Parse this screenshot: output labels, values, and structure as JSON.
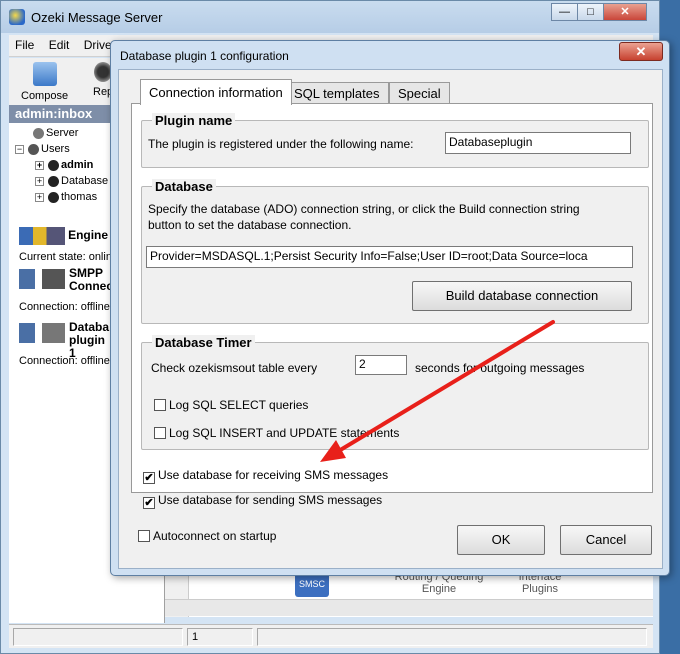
{
  "main_window": {
    "title": "Ozeki Message Server",
    "window_buttons": [
      "—",
      "□",
      "✕"
    ],
    "menu": [
      "File",
      "Edit",
      "Driver"
    ],
    "toolbar": [
      {
        "label": "Compose",
        "icon": "compose-icon"
      },
      {
        "label": "Rep",
        "icon": "reply-icon"
      }
    ],
    "tree_header": "admin:inbox",
    "tree": {
      "server": "Server",
      "users": "Users",
      "admin": "admin",
      "database": "Database",
      "thomas": "thomas"
    },
    "connections": [
      {
        "name": "Engine",
        "state": "Current state: online"
      },
      {
        "name_line1": "SMPP",
        "name_line2": "Connect",
        "state": "Connection: offline"
      },
      {
        "name_line1": "Databa",
        "name_line2": "plugin 1",
        "state": "Connection: offline"
      }
    ],
    "background_labels": {
      "routing_line1": "Routing / Queuing",
      "routing_line2": "Engine",
      "interface_line1": "Interface",
      "interface_line2": "Plugins",
      "smsc": "SMSC"
    },
    "status_page": "1"
  },
  "dialog": {
    "title": "Database plugin 1 configuration",
    "close_symbol": "✕",
    "tabs": [
      "Connection information",
      "SQL templates",
      "Special"
    ],
    "active_tab": 0,
    "plugin_name": {
      "title": "Plugin name",
      "text": "The plugin is registered under the following name:",
      "value": "Databaseplugin"
    },
    "database": {
      "title": "Database",
      "desc_line1": "Specify the database (ADO) connection string, or click the Build connection string",
      "desc_line2": "button to set the database connection.",
      "connection_string": "Provider=MSDASQL.1;Persist Security Info=False;User ID=root;Data Source=loca",
      "build_button": "Build database connection"
    },
    "timer": {
      "title": "Database Timer",
      "prefix": "Check ozekismsout table every",
      "seconds": "2",
      "suffix": "seconds for outgoing messages",
      "log_select": "Log SQL SELECT queries",
      "log_select_checked": false,
      "log_insert": "Log SQL INSERT and UPDATE statements",
      "log_insert_checked": false
    },
    "use_receiving": "Use database for receiving SMS messages",
    "use_receiving_checked": true,
    "use_sending": "Use database for sending SMS messages",
    "use_sending_checked": true,
    "autoconnect": "Autoconnect on startup",
    "autoconnect_checked": false,
    "ok_button": "OK",
    "cancel_button": "Cancel"
  },
  "annotation": {
    "arrow_color": "#e8201a"
  }
}
